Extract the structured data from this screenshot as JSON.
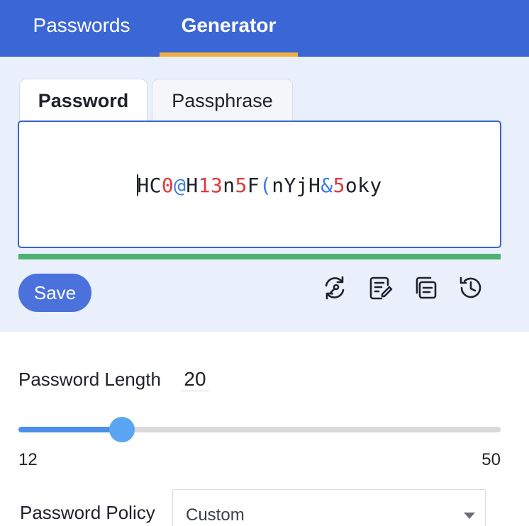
{
  "nav": {
    "tabs": [
      {
        "label": "Passwords"
      },
      {
        "label": "Generator"
      }
    ],
    "active": "Generator"
  },
  "generator": {
    "subtabs": [
      {
        "label": "Password"
      },
      {
        "label": "Passphrase"
      }
    ],
    "active_subtab": "Password",
    "password_segments": [
      {
        "text": "HC",
        "kind": "letter"
      },
      {
        "text": "0",
        "kind": "digit"
      },
      {
        "text": "@",
        "kind": "symbol"
      },
      {
        "text": "H",
        "kind": "letter"
      },
      {
        "text": "13",
        "kind": "digit"
      },
      {
        "text": "n",
        "kind": "letter"
      },
      {
        "text": "5",
        "kind": "digit"
      },
      {
        "text": "F",
        "kind": "letter"
      },
      {
        "text": "(",
        "kind": "symbol"
      },
      {
        "text": "nYjH",
        "kind": "letter"
      },
      {
        "text": "&",
        "kind": "symbol"
      },
      {
        "text": "5",
        "kind": "digit"
      },
      {
        "text": "oky",
        "kind": "letter"
      }
    ],
    "colors": {
      "letter": "#1e2128",
      "digit": "#e0393e",
      "symbol": "#3b7fe0",
      "strength": "#4fb070",
      "accent": "#3b67d6"
    },
    "save_label": "Save",
    "actions": [
      {
        "name": "regenerate-icon"
      },
      {
        "name": "edit-icon"
      },
      {
        "name": "copy-icon"
      },
      {
        "name": "history-icon"
      }
    ]
  },
  "length": {
    "label": "Password Length",
    "value": "20",
    "min": "12",
    "max": "50",
    "current": 20
  },
  "policy": {
    "label": "Password Policy",
    "selected": "Custom"
  }
}
